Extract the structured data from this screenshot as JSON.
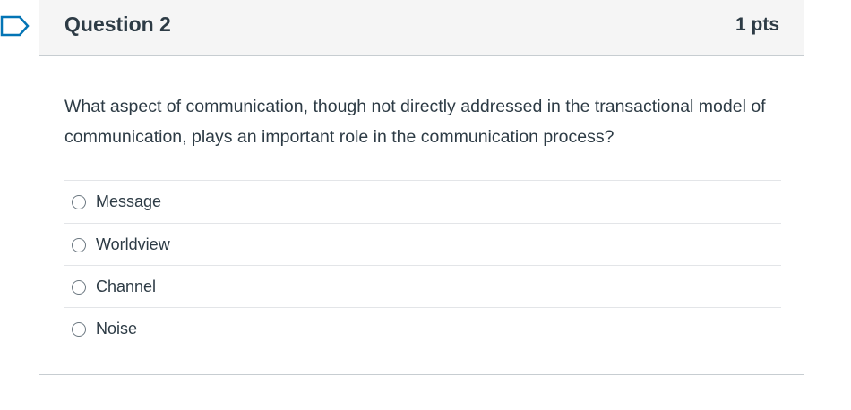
{
  "question": {
    "title": "Question 2",
    "points": "1 pts",
    "text": "What aspect of communication, though not directly addressed in the transactional model of communication, plays an important role in the communication process?"
  },
  "answers": [
    {
      "label": "Message",
      "selected": false
    },
    {
      "label": "Worldview",
      "selected": false
    },
    {
      "label": "Channel",
      "selected": false
    },
    {
      "label": "Noise",
      "selected": false
    }
  ],
  "colors": {
    "flag": "#0374b5",
    "text": "#2d3b45",
    "header_bg": "#f5f5f5",
    "border": "#c7cdd1"
  },
  "icons": {
    "flag": "flag-question-icon"
  }
}
